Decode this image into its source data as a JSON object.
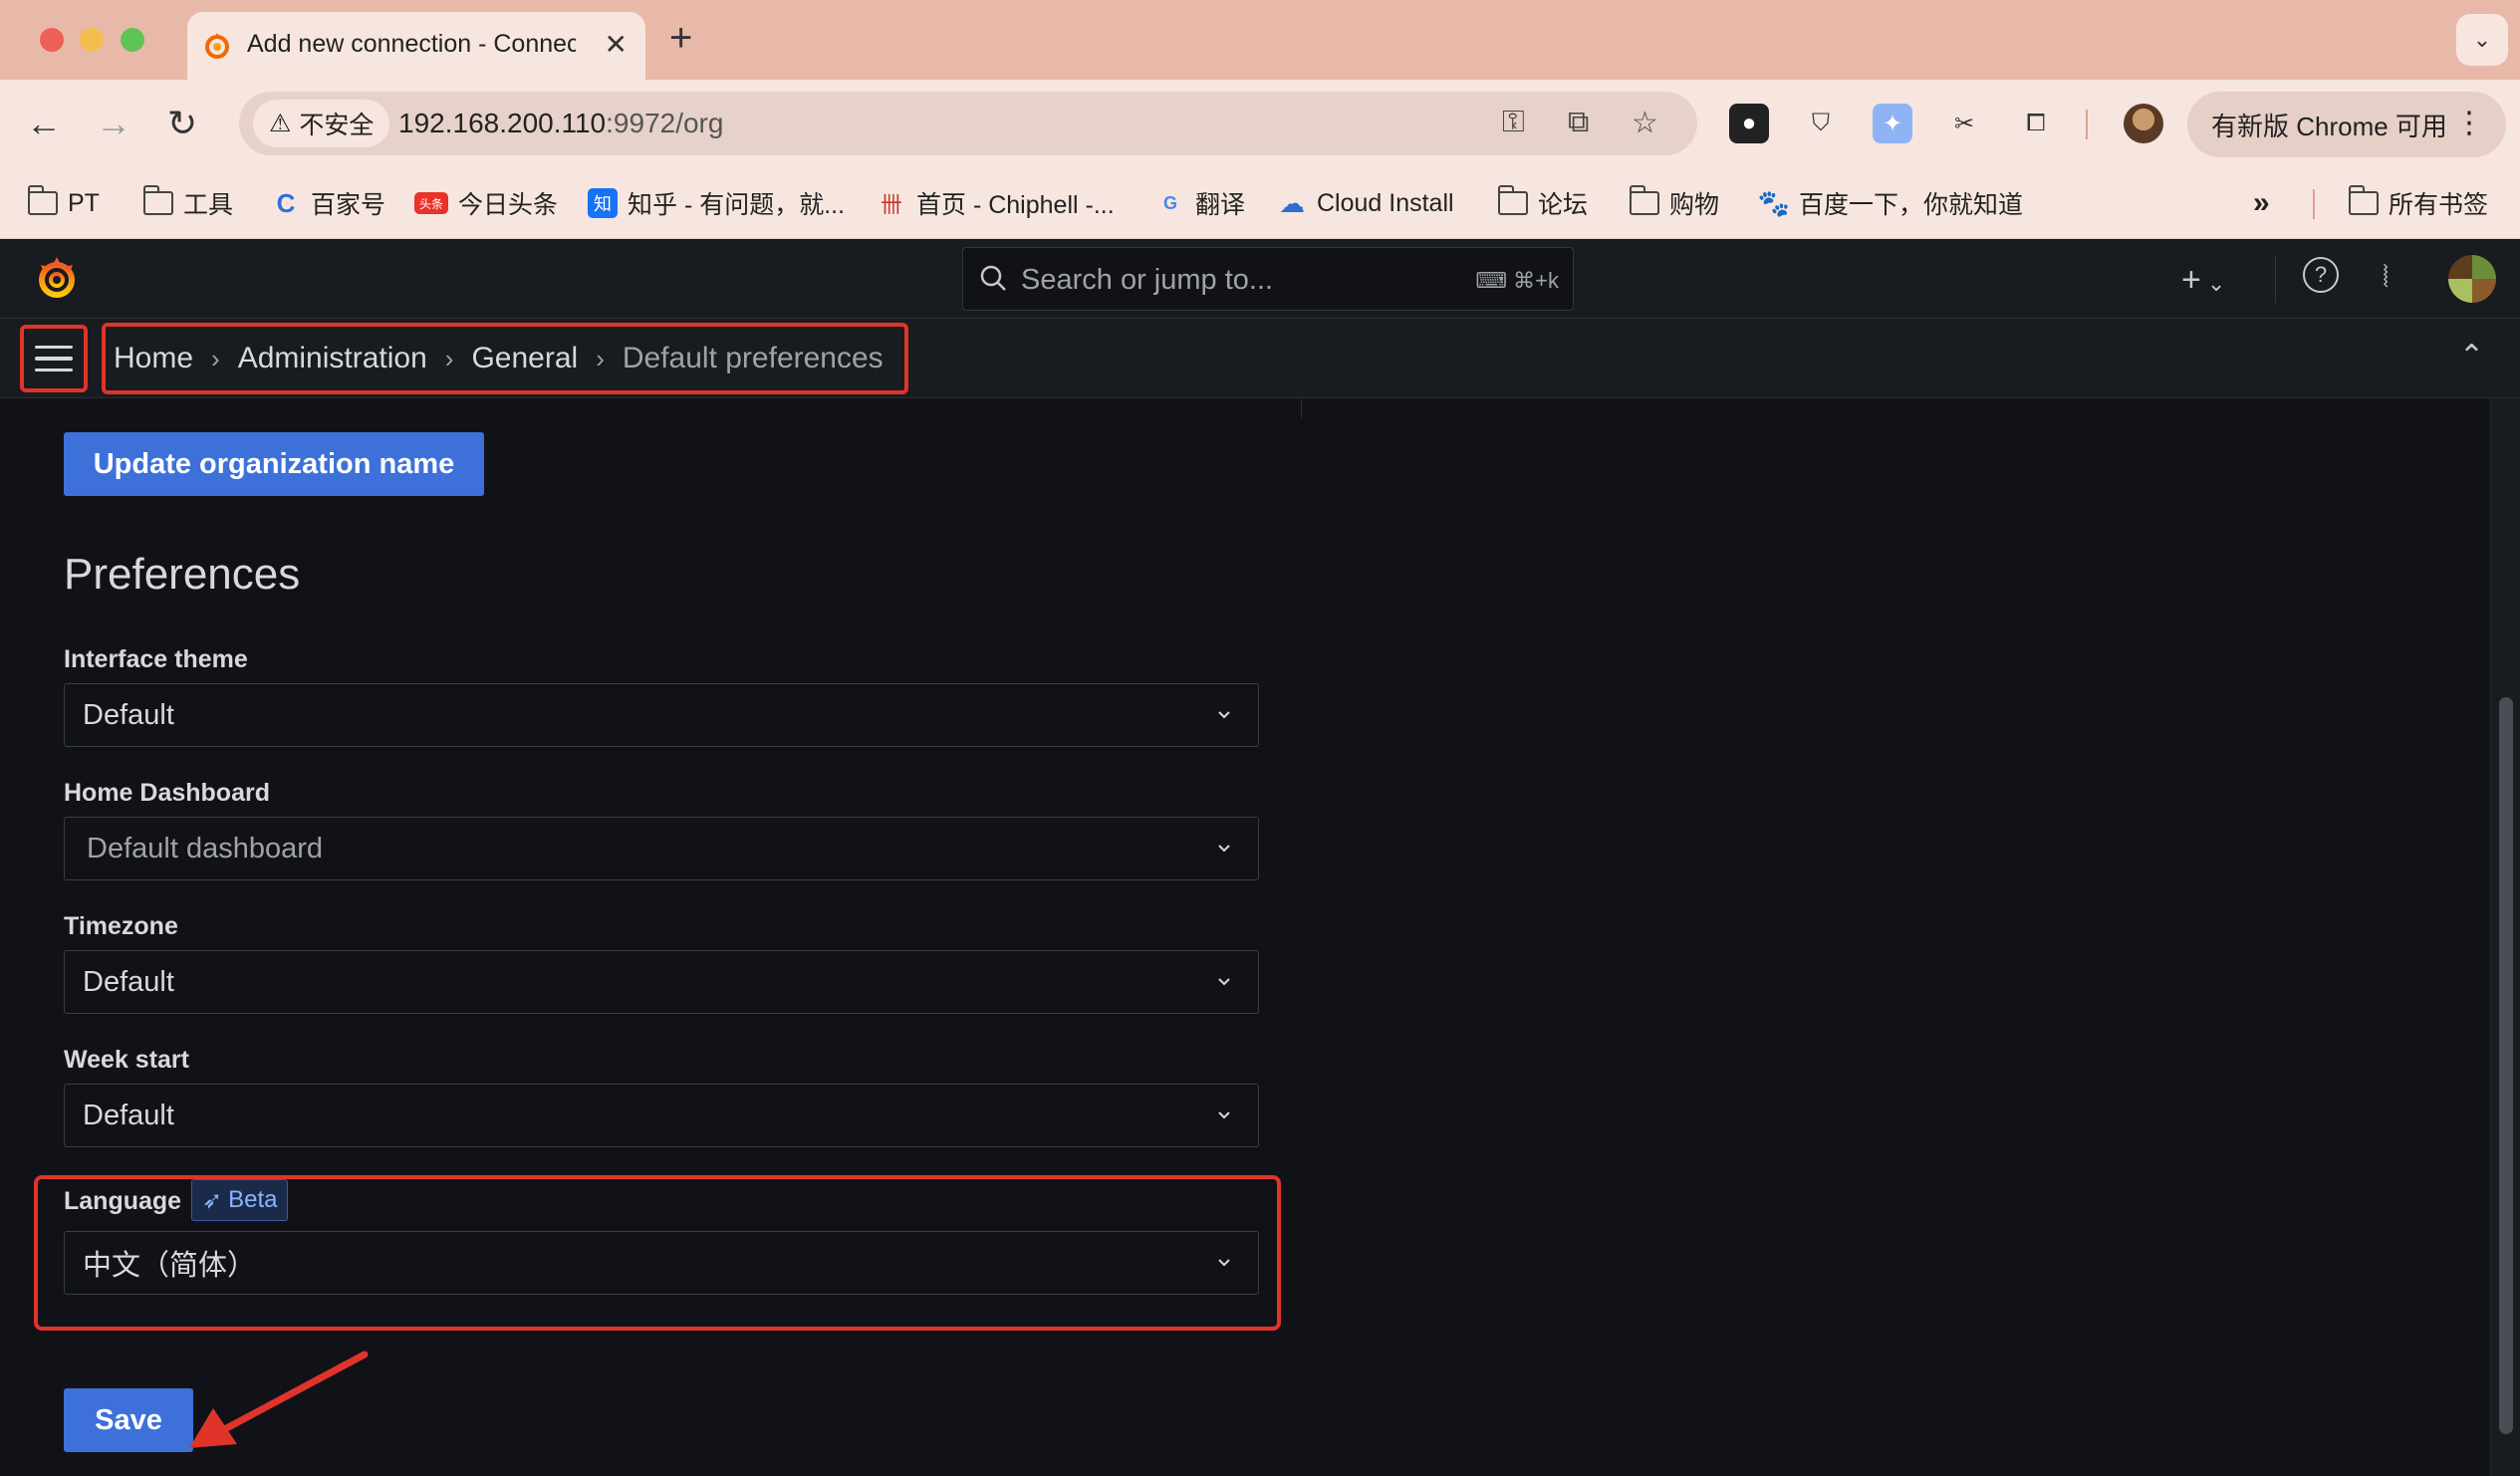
{
  "browser": {
    "tab_title": "Add new connection - Connec",
    "url_host": "192.168.200.110",
    "url_path": ":9972/org",
    "security_label": "不安全",
    "update_label": "有新版 Chrome 可用"
  },
  "bookmarks": [
    {
      "label": "PT",
      "icon": "folder-icon"
    },
    {
      "label": "工具",
      "icon": "folder-icon"
    },
    {
      "label": "百家号",
      "icon": "baijiahao-icon"
    },
    {
      "label": "今日头条",
      "icon": "toutiao-icon"
    },
    {
      "label": "知乎 - 有问题，就...",
      "icon": "zhihu-icon"
    },
    {
      "label": "首页 - Chiphell -...",
      "icon": "chiphell-icon"
    },
    {
      "label": "翻译",
      "icon": "translate-icon"
    },
    {
      "label": "Cloud Install",
      "icon": "cloud-icon"
    },
    {
      "label": "论坛",
      "icon": "folder-icon"
    },
    {
      "label": "购物",
      "icon": "folder-icon"
    },
    {
      "label": "百度一下，你就知道",
      "icon": "baidu-icon"
    }
  ],
  "bookmarks_all": "所有书签",
  "grafana": {
    "search_placeholder": "Search or jump to...",
    "search_shortcut": "⌘+k",
    "breadcrumb": [
      "Home",
      "Administration",
      "General",
      "Default preferences"
    ],
    "update_org_button": "Update organization name",
    "section_title": "Preferences",
    "fields": {
      "interface_theme": {
        "label": "Interface theme",
        "value": "Default"
      },
      "home_dashboard": {
        "label": "Home Dashboard",
        "placeholder": "Default dashboard"
      },
      "timezone": {
        "label": "Timezone",
        "value": "Default"
      },
      "week_start": {
        "label": "Week start",
        "value": "Default"
      },
      "language": {
        "label": "Language",
        "badge": "Beta",
        "value": "中文（简体）"
      }
    },
    "save_button": "Save"
  },
  "colors": {
    "accent": "#3d71d9",
    "annotation": "#e0342b",
    "background": "#111217"
  }
}
